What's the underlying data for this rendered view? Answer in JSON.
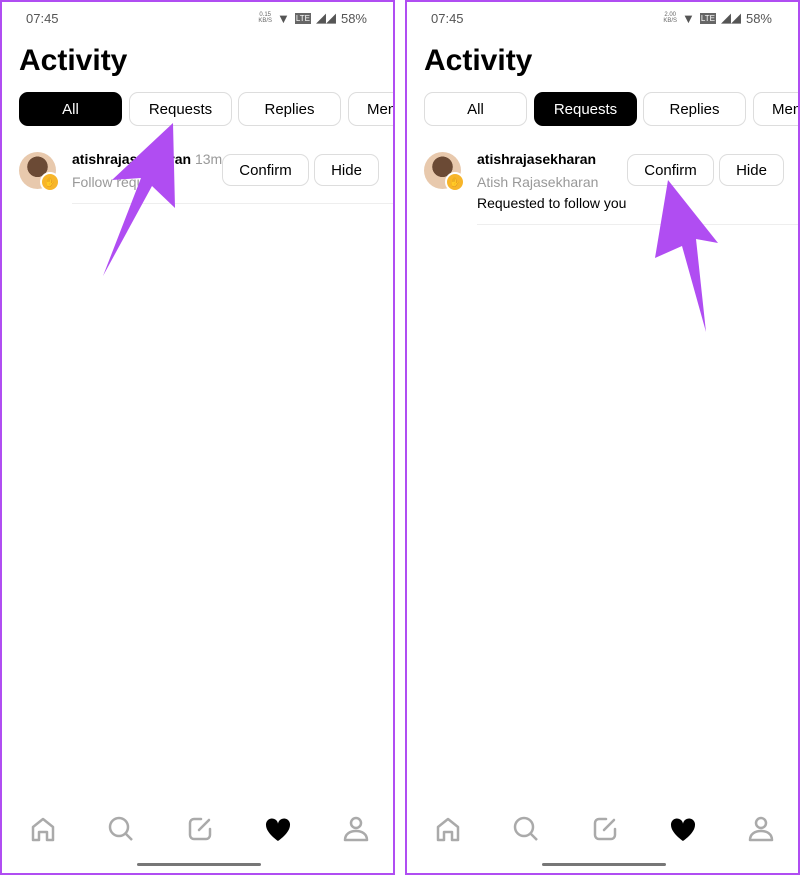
{
  "accent_color": "#b04df2",
  "screens": [
    {
      "status": {
        "time": "07:45",
        "speed_value": "0.15",
        "speed_unit": "KB/S",
        "battery": "58%"
      },
      "title": "Activity",
      "tabs": [
        {
          "label": "All",
          "active": true
        },
        {
          "label": "Requests",
          "active": false
        },
        {
          "label": "Replies",
          "active": false
        },
        {
          "label": "Mentions",
          "active": false
        }
      ],
      "item": {
        "username": "atishrajasekharan",
        "time": "13m",
        "text": "Follow request",
        "confirm": "Confirm",
        "hide": "Hide"
      },
      "nav": [
        "home-icon",
        "search-icon",
        "compose-icon",
        "heart-icon",
        "profile-icon"
      ]
    },
    {
      "status": {
        "time": "07:45",
        "speed_value": "2.00",
        "speed_unit": "KB/S",
        "battery": "58%"
      },
      "title": "Activity",
      "tabs": [
        {
          "label": "All",
          "active": false
        },
        {
          "label": "Requests",
          "active": true
        },
        {
          "label": "Replies",
          "active": false
        },
        {
          "label": "Mentions",
          "active": false
        }
      ],
      "item": {
        "username": "atishrajasekharan",
        "fullname": "Atish Rajasekharan",
        "text": "Requested to follow you",
        "confirm": "Confirm",
        "hide": "Hide"
      },
      "nav": [
        "home-icon",
        "search-icon",
        "compose-icon",
        "heart-icon",
        "profile-icon"
      ]
    }
  ]
}
